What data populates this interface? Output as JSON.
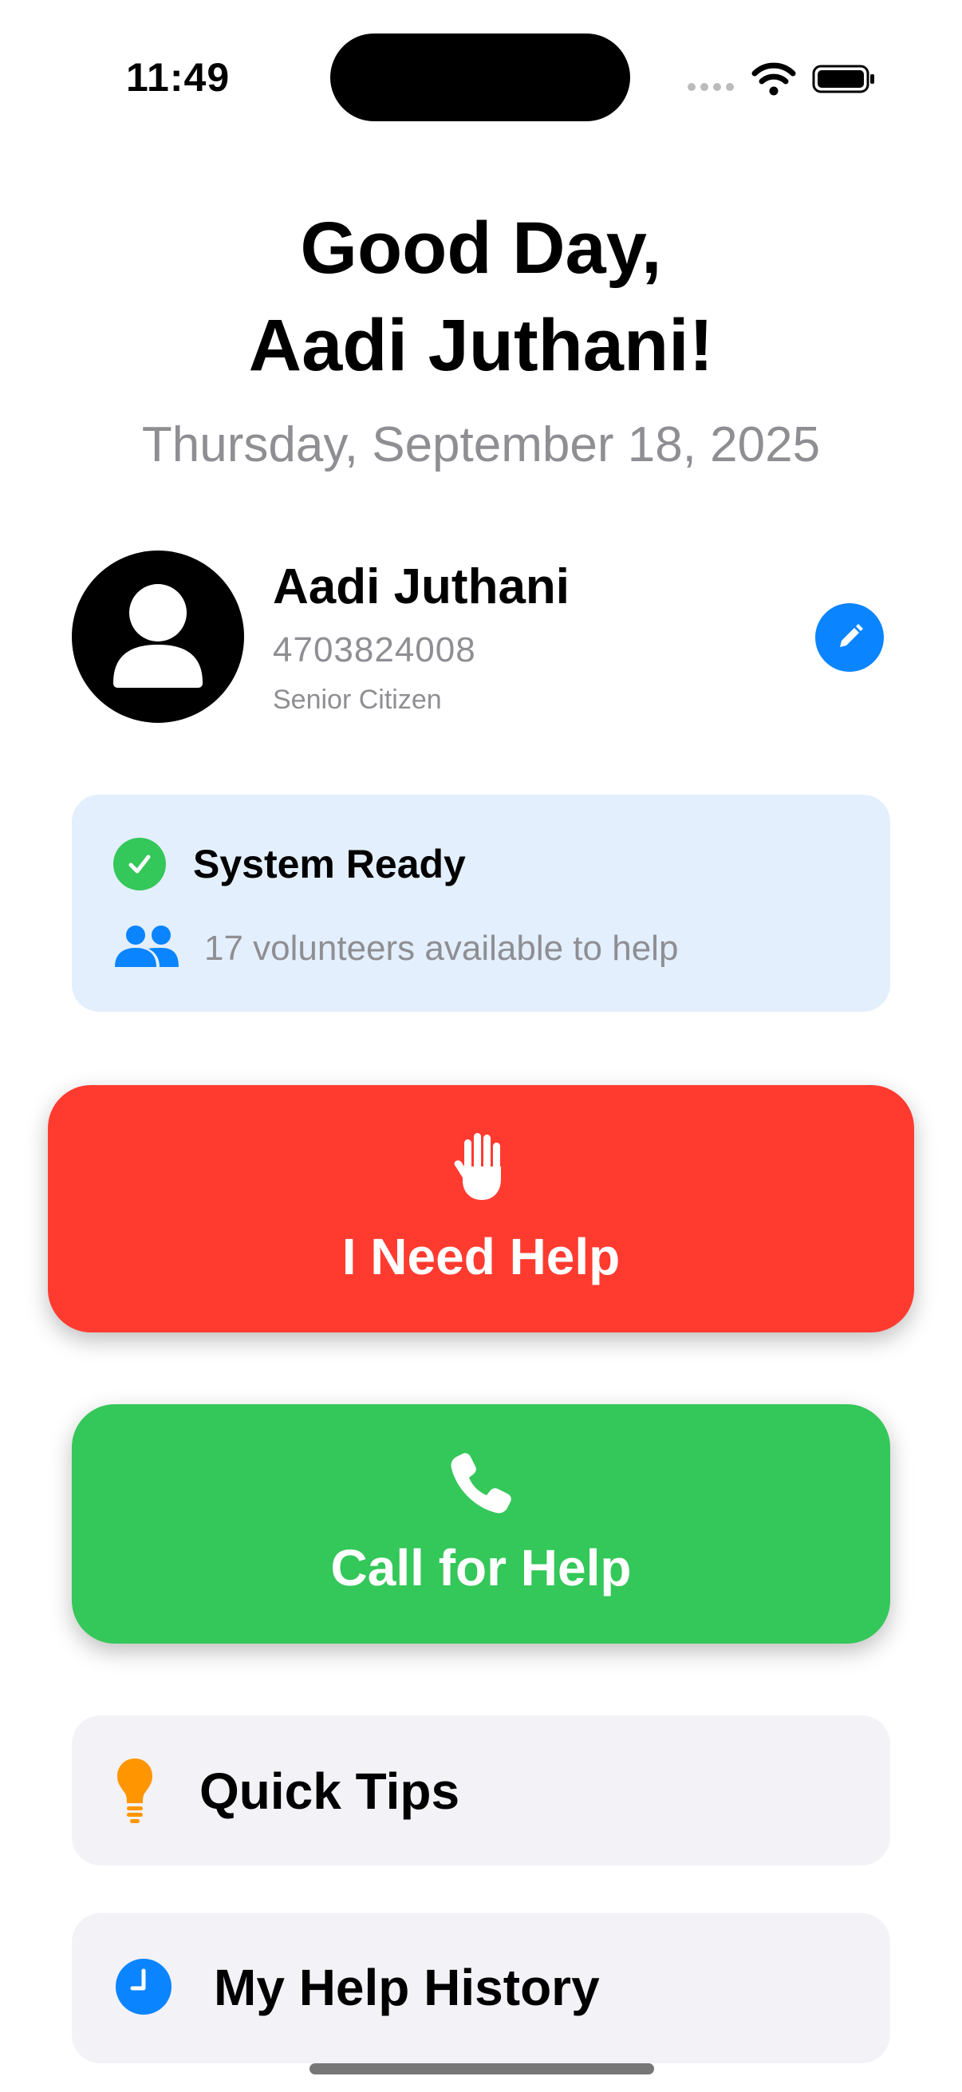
{
  "status_bar": {
    "time": "11:49"
  },
  "greeting": {
    "line1": "Good Day,",
    "line2": "Aadi Juthani!",
    "date": "Thursday, September 18, 2025"
  },
  "profile": {
    "name": "Aadi Juthani",
    "phone": "4703824008",
    "role": "Senior Citizen",
    "avatar_icon": "person-icon",
    "edit_icon": "pencil-icon"
  },
  "system_status": {
    "title": "System Ready",
    "volunteers_text": "17 volunteers available to help",
    "status_icon": "checkmark-circle-icon",
    "volunteers_icon": "people-icon"
  },
  "actions": {
    "need_help": {
      "label": "I Need Help",
      "icon": "raised-hand-icon",
      "color": "#ff3b30"
    },
    "call_help": {
      "label": "Call for Help",
      "icon": "phone-icon",
      "color": "#34c759"
    }
  },
  "menu": {
    "quick_tips": {
      "label": "Quick Tips",
      "icon": "lightbulb-icon",
      "icon_color": "#ff9500"
    },
    "help_history": {
      "label": "My Help History",
      "icon": "clock-icon",
      "icon_color": "#0a84ff"
    }
  },
  "colors": {
    "accent_blue": "#0a84ff",
    "status_card_bg": "#e3effc",
    "secondary_text": "#8e8e93",
    "row_bg": "#f2f2f7"
  }
}
